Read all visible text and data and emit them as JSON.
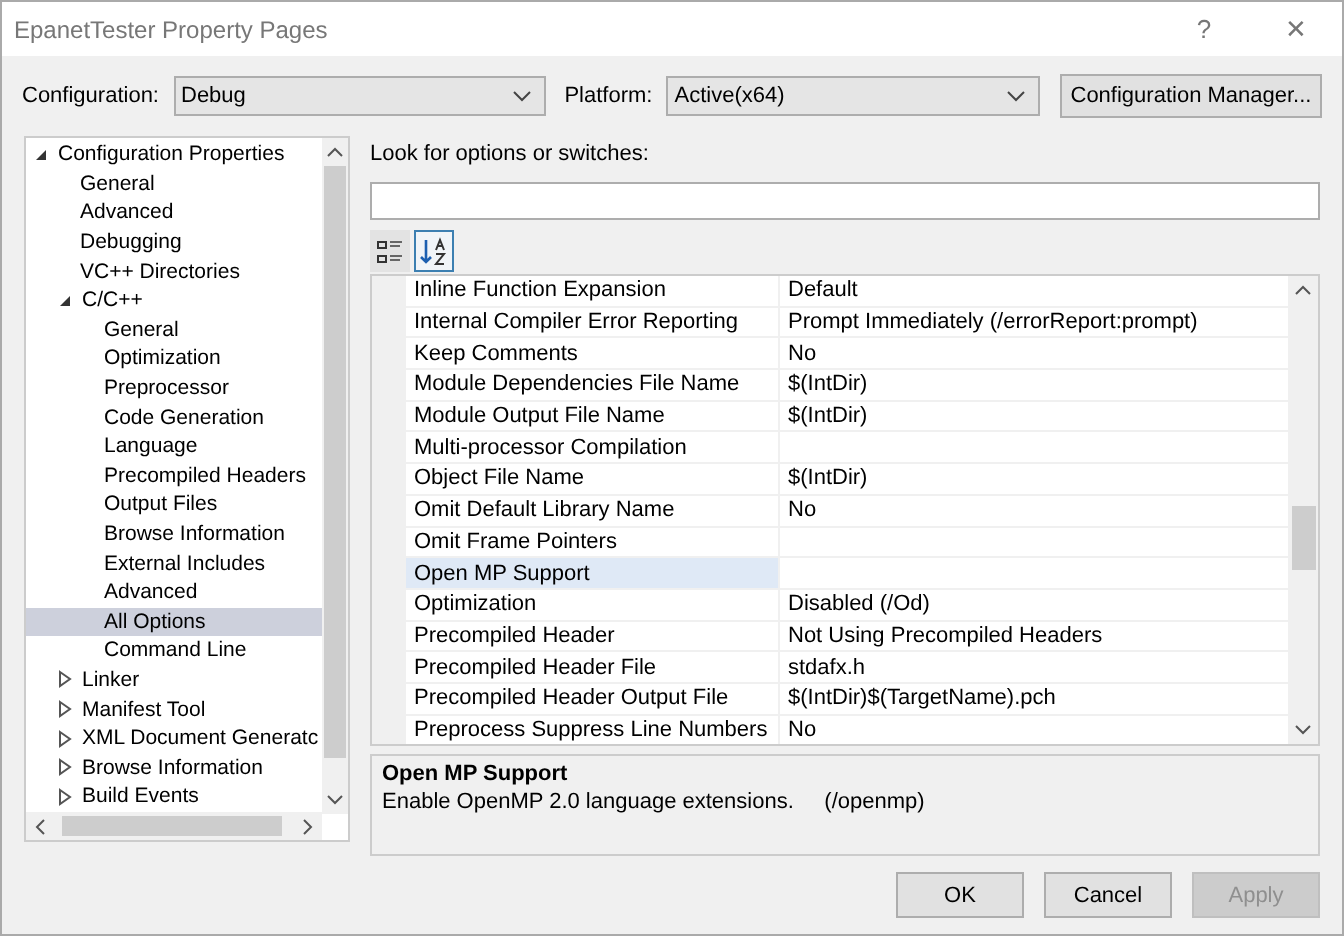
{
  "window": {
    "title": "EpanetTester Property Pages",
    "help": "?",
    "close": "✕"
  },
  "configuration": {
    "label": "Configuration:",
    "value": "Debug"
  },
  "platform": {
    "label": "Platform:",
    "value": "Active(x64)"
  },
  "config_manager_button": "Configuration Manager...",
  "tree": [
    {
      "label": "Configuration Properties",
      "expanded": true,
      "selected": false,
      "children": [
        {
          "label": "General",
          "selected": false
        },
        {
          "label": "Advanced",
          "selected": false
        },
        {
          "label": "Debugging",
          "selected": false
        },
        {
          "label": "VC++ Directories",
          "selected": false
        },
        {
          "label": "C/C++",
          "expanded": true,
          "selected": false,
          "children": [
            {
              "label": "General",
              "selected": false
            },
            {
              "label": "Optimization",
              "selected": false
            },
            {
              "label": "Preprocessor",
              "selected": false
            },
            {
              "label": "Code Generation",
              "selected": false
            },
            {
              "label": "Language",
              "selected": false
            },
            {
              "label": "Precompiled Headers",
              "selected": false
            },
            {
              "label": "Output Files",
              "selected": false
            },
            {
              "label": "Browse Information",
              "selected": false
            },
            {
              "label": "External Includes",
              "selected": false
            },
            {
              "label": "Advanced",
              "selected": false
            },
            {
              "label": "All Options",
              "selected": true
            },
            {
              "label": "Command Line",
              "selected": false
            }
          ]
        },
        {
          "label": "Linker",
          "expanded": false,
          "selected": false
        },
        {
          "label": "Manifest Tool",
          "expanded": false,
          "selected": false
        },
        {
          "label": "XML Document Generatc",
          "expanded": false,
          "selected": false
        },
        {
          "label": "Browse Information",
          "expanded": false,
          "selected": false
        },
        {
          "label": "Build Events",
          "expanded": false,
          "selected": false
        }
      ]
    }
  ],
  "search": {
    "label": "Look for options or switches:"
  },
  "view_buttons": [
    {
      "kind": "categorized",
      "selected": false
    },
    {
      "kind": "alphabetical",
      "selected": true
    }
  ],
  "properties": [
    {
      "name": "Inline Function Expansion",
      "value": "Default",
      "selected": false
    },
    {
      "name": "Internal Compiler Error Reporting",
      "value": "Prompt Immediately (/errorReport:prompt)",
      "selected": false
    },
    {
      "name": "Keep Comments",
      "value": "No",
      "selected": false
    },
    {
      "name": "Module Dependencies File Name",
      "value": "$(IntDir)",
      "selected": false
    },
    {
      "name": "Module Output File Name",
      "value": "$(IntDir)",
      "selected": false
    },
    {
      "name": "Multi-processor Compilation",
      "selected": false
    },
    {
      "name": "Object File Name",
      "value": "$(IntDir)",
      "selected": false
    },
    {
      "name": "Omit Default Library Name",
      "value": "No",
      "selected": false
    },
    {
      "name": "Omit Frame Pointers",
      "selected": false
    },
    {
      "name": "Open MP Support",
      "selected": true
    },
    {
      "name": "Optimization",
      "value": "Disabled (/Od)",
      "selected": false
    },
    {
      "name": "Precompiled Header",
      "value": "Not Using Precompiled Headers",
      "selected": false
    },
    {
      "name": "Precompiled Header File",
      "value": "stdafx.h",
      "selected": false
    },
    {
      "name": "Precompiled Header Output File",
      "value": "$(IntDir)$(TargetName).pch",
      "selected": false
    },
    {
      "name": "Preprocess Suppress Line Numbers",
      "value": "No",
      "selected": false
    }
  ],
  "description": {
    "title": "Open MP Support",
    "text": "Enable OpenMP 2.0 language extensions.     (/openmp)"
  },
  "buttons": [
    {
      "label": "OK",
      "disabled": false
    },
    {
      "label": "Cancel",
      "disabled": false
    },
    {
      "label": "Apply",
      "disabled": true
    }
  ]
}
